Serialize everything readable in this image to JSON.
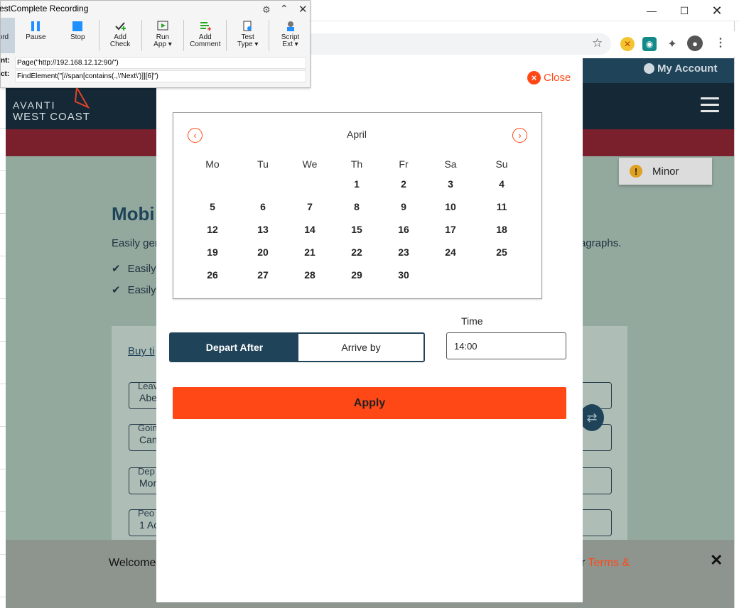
{
  "testcomplete": {
    "title": "TestComplete Recording",
    "tools": [
      {
        "label": "Record",
        "icon": "record-icon"
      },
      {
        "label": "Pause",
        "icon": "pause-icon"
      },
      {
        "label": "Stop",
        "icon": "stop-icon"
      },
      {
        "label": "Add\nCheck",
        "icon": "add-check-icon"
      },
      {
        "label": "Run\nApp ▾",
        "icon": "run-app-icon"
      },
      {
        "label": "Add\nComment",
        "icon": "add-comment-icon"
      },
      {
        "label": "Test\nType ▾",
        "icon": "test-type-icon"
      },
      {
        "label": "Script\nExt ▾",
        "icon": "script-ext-icon"
      }
    ],
    "row1_key": "nt:",
    "row1_value": "Page(\"http://192.168.12.12:90/\")",
    "row2_key": "ct:",
    "row2_value": "FindElement(\"[//span[contains(.,\\'Next\\')]][6]\")"
  },
  "browser": {
    "account_label": "My Account"
  },
  "site": {
    "logo_line1": "AVANTI",
    "logo_line2": "WEST COAST",
    "minor_label": "Minor",
    "heading_partial": "Mobi",
    "intro_partial": "Easily ger",
    "intro_end_partial": "agraphs.",
    "bullet1_partial": "Easily",
    "bullet2_partial": "Easily",
    "card_tab_partial": "Buy ti",
    "fields": [
      {
        "label": "Leav",
        "value": "Abe"
      },
      {
        "label": "Goin",
        "value": "Can"
      },
      {
        "label": "Dep",
        "value": "Mor"
      },
      {
        "label": "Peo",
        "value": "1 Ac"
      }
    ],
    "cookie_text_partial": "Welcome",
    "cookie_link_prefix": "r",
    "cookie_link": "Terms &"
  },
  "modal": {
    "close_label": "Close",
    "calendar": {
      "month": "April",
      "weekdays": [
        "Mo",
        "Tu",
        "We",
        "Th",
        "Fr",
        "Sa",
        "Su"
      ],
      "weeks": [
        [
          "",
          "",
          "",
          "1",
          "2",
          "3",
          "4"
        ],
        [
          "5",
          "6",
          "7",
          "8",
          "9",
          "10",
          "11"
        ],
        [
          "12",
          "13",
          "14",
          "15",
          "16",
          "17",
          "18"
        ],
        [
          "19",
          "20",
          "21",
          "22",
          "23",
          "24",
          "25"
        ],
        [
          "26",
          "27",
          "28",
          "29",
          "30",
          "",
          ""
        ]
      ]
    },
    "depart_after_label": "Depart After",
    "arrive_by_label": "Arrive by",
    "time_label": "Time",
    "time_value": "14:00",
    "apply_label": "Apply"
  },
  "colors": {
    "accent": "#ff4815",
    "navy": "#1f4359",
    "dark_nav": "#142836",
    "brand_red": "#7a1f2c"
  }
}
